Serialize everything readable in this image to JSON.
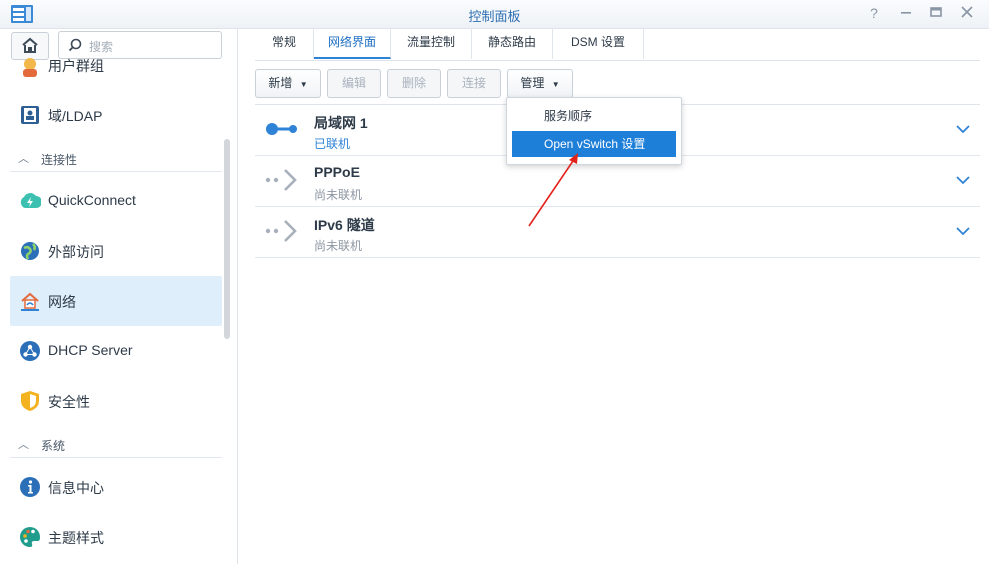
{
  "window": {
    "title": "控制面板"
  },
  "sidebar": {
    "search_placeholder": "搜索",
    "items": [
      {
        "label": "用户群组",
        "icon": "user-group-icon"
      },
      {
        "label": "域/LDAP",
        "icon": "ldap-icon"
      },
      {
        "label": "QuickConnect",
        "icon": "quickconnect-icon"
      },
      {
        "label": "外部访问",
        "icon": "external-access-icon"
      },
      {
        "label": "网络",
        "icon": "network-icon"
      },
      {
        "label": "DHCP Server",
        "icon": "dhcp-icon"
      },
      {
        "label": "安全性",
        "icon": "shield-icon"
      },
      {
        "label": "信息中心",
        "icon": "info-icon"
      },
      {
        "label": "主题样式",
        "icon": "palette-icon"
      }
    ],
    "sections": [
      {
        "label": "连接性"
      },
      {
        "label": "系统"
      }
    ],
    "active_item": "网络"
  },
  "tabs": [
    {
      "label": "常规"
    },
    {
      "label": "网络界面"
    },
    {
      "label": "流量控制"
    },
    {
      "label": "静态路由"
    },
    {
      "label": "DSM 设置"
    }
  ],
  "toolbar": {
    "add": "新增",
    "edit": "编辑",
    "delete": "删除",
    "connect": "连接",
    "manage": "管理"
  },
  "interfaces": [
    {
      "name": "局域网 1",
      "status": "已联机"
    },
    {
      "name": "PPPoE",
      "status": "尚未联机"
    },
    {
      "name": "IPv6 隧道",
      "status": "尚未联机"
    }
  ],
  "manage_menu": {
    "items": [
      {
        "label": "服务顺序"
      },
      {
        "label": "Open vSwitch 设置"
      }
    ],
    "highlighted": "Open vSwitch 设置"
  },
  "colors": {
    "accent": "#2f83d6",
    "highlight": "#1e7fd8",
    "annotation_arrow": "#e2231a"
  }
}
